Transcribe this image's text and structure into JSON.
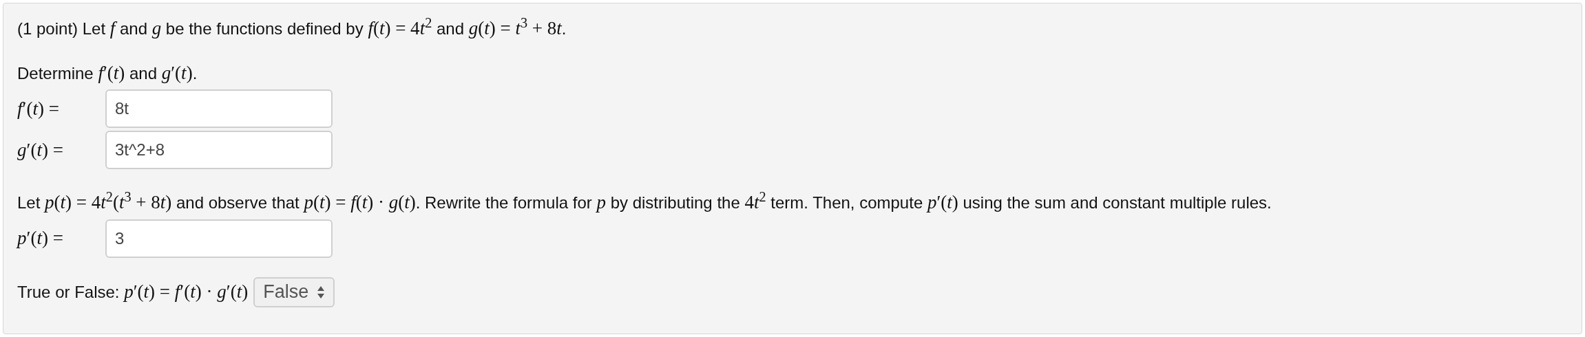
{
  "intro": [
    {
      "kind": "text",
      "s": "(1 point) Let "
    },
    {
      "kind": "math",
      "s": "*f*"
    },
    {
      "kind": "text",
      "s": " and "
    },
    {
      "kind": "math",
      "s": "*g*"
    },
    {
      "kind": "text",
      "s": " be the functions defined by "
    },
    {
      "kind": "math",
      "s": "*f*(*t*) = 4"
    },
    {
      "kind": "math",
      "s": "*t*$^{2}$"
    },
    {
      "kind": "text",
      "s": " and "
    },
    {
      "kind": "math",
      "s": "*g*(*t*) = *t*$^{3}$ + 8"
    },
    {
      "kind": "math",
      "s": "*t*"
    },
    {
      "kind": "text",
      "s": "."
    }
  ],
  "prompt_1": [
    {
      "kind": "text",
      "s": "Determine "
    },
    {
      "kind": "math",
      "s": "*f*′(*t*)"
    },
    {
      "kind": "text",
      "s": " and "
    },
    {
      "kind": "math",
      "s": "*g*′(*t*)"
    },
    {
      "kind": "text",
      "s": "."
    }
  ],
  "answers_1": [
    {
      "label": "*f*′(*t*) =",
      "value": "8t"
    },
    {
      "label": "*g*′(*t*) =",
      "value": "3t^2+8"
    }
  ],
  "prompt_2": [
    {
      "kind": "text",
      "s": "Let "
    },
    {
      "kind": "math",
      "s": "*p*(*t*) = 4"
    },
    {
      "kind": "math",
      "s": "*t*$^{2}$(*t*$^{3}$ + 8"
    },
    {
      "kind": "math",
      "s": "*t*)"
    },
    {
      "kind": "text",
      "s": " and observe that "
    },
    {
      "kind": "math",
      "s": "*p*(*t*) = *f*(*t*) · *g*(*t*)"
    },
    {
      "kind": "text",
      "s": ". Rewrite the formula for "
    },
    {
      "kind": "math",
      "s": "*p*"
    },
    {
      "kind": "text",
      "s": " by distributing the "
    },
    {
      "kind": "math",
      "s": "4"
    },
    {
      "kind": "math",
      "s": "*t*$^{2}$"
    },
    {
      "kind": "text",
      "s": " term. Then, compute "
    },
    {
      "kind": "math",
      "s": "*p*′(*t*)"
    },
    {
      "kind": "text",
      "s": " using the sum and constant multiple rules."
    }
  ],
  "answers_2": [
    {
      "label": "*p*′(*t*) =",
      "value": "3"
    }
  ],
  "true_false": {
    "question": [
      {
        "kind": "text",
        "s": "True or False: "
      },
      {
        "kind": "math",
        "s": "*p*′(*t*) = *f*′(*t*) · *g*′(*t*)"
      }
    ],
    "value": "False"
  }
}
